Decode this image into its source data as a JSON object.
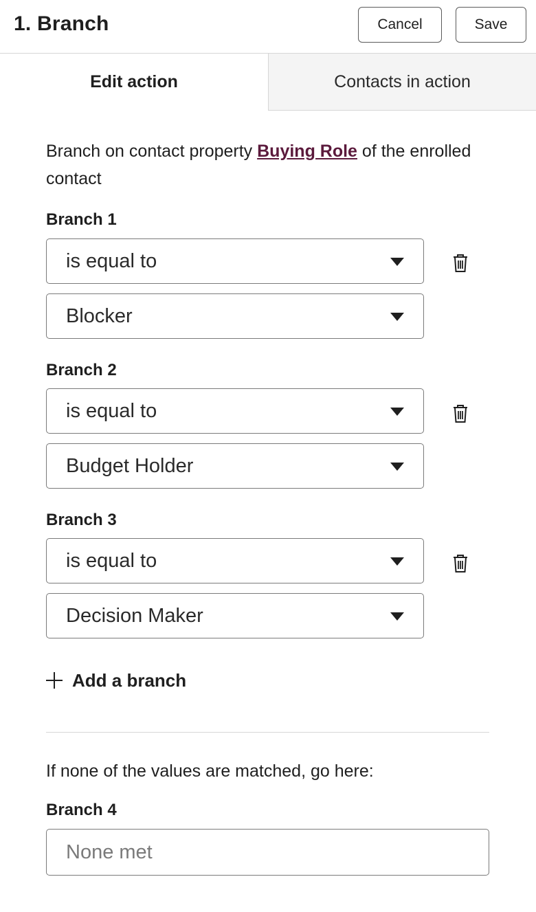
{
  "header": {
    "title": "1. Branch",
    "cancel_label": "Cancel",
    "save_label": "Save"
  },
  "tabs": [
    {
      "label": "Edit action",
      "active": true
    },
    {
      "label": "Contacts in action",
      "active": false
    }
  ],
  "description": {
    "prefix": "Branch on contact property ",
    "property": "Buying Role",
    "suffix": " of the enrolled contact"
  },
  "branches": [
    {
      "label": "Branch 1",
      "operator": "is equal to",
      "value": "Blocker"
    },
    {
      "label": "Branch 2",
      "operator": "is equal to",
      "value": "Budget Holder"
    },
    {
      "label": "Branch 3",
      "operator": "is equal to",
      "value": "Decision Maker"
    }
  ],
  "add_branch_label": "Add a branch",
  "fallback": {
    "text": "If none of the values are matched, go here:",
    "label": "Branch 4",
    "placeholder": "None met"
  },
  "icons": {
    "delete": "trash-icon",
    "dropdown": "caret-down-icon",
    "add": "plus-icon"
  },
  "colors": {
    "link": "#5b1a3c",
    "border": "#7a7a7a",
    "inactive_tab_bg": "#f4f4f4"
  }
}
